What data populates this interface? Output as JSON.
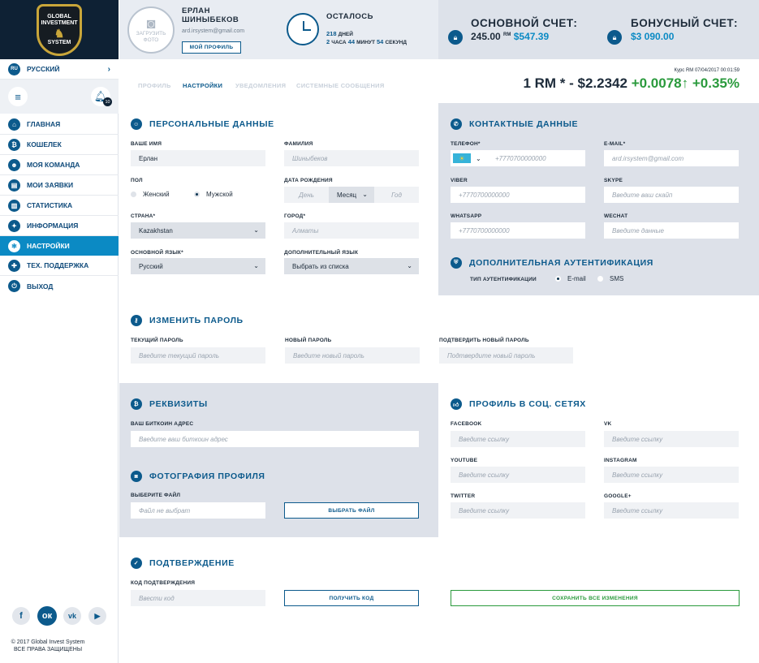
{
  "sidebar": {
    "logo": {
      "line1": "GLOBAL",
      "line2": "INVESTMENT",
      "line3": "SYSTEM"
    },
    "language": {
      "code": "RU",
      "label": "Русский"
    },
    "notifications_count": "10",
    "items": [
      {
        "label": "Главная",
        "icon": "home-icon"
      },
      {
        "label": "Кошелек",
        "icon": "bitcoin-icon"
      },
      {
        "label": "Моя команда",
        "icon": "team-icon"
      },
      {
        "label": "Мои заявки",
        "icon": "document-icon"
      },
      {
        "label": "Статистика",
        "icon": "chart-icon"
      },
      {
        "label": "Информация",
        "icon": "bulb-icon"
      },
      {
        "label": "Настройки",
        "icon": "gear-icon"
      },
      {
        "label": "Тех. поддержка",
        "icon": "lifebuoy-icon"
      },
      {
        "label": "Выход",
        "icon": "power-icon"
      }
    ],
    "socials": [
      "f",
      "ок",
      "vk",
      "▶"
    ],
    "copyright_line1": "© 2017 Global Invest System",
    "copyright_line2": "ВСЕ ПРАВА ЗАЩИЩЕНЫ"
  },
  "header": {
    "upload_photo": "загрузить фото",
    "user_name_line1": "Ерлан",
    "user_name_line2": "Шиныбеков",
    "user_email": "ard.irsystem@gmail.com",
    "profile_button": "Мой профиль",
    "remaining_title": "Осталось",
    "days_value": "218",
    "days_label": "дней",
    "hours_value": "2",
    "hours_label": "часа",
    "minutes_value": "44",
    "minutes_label": "минут",
    "seconds_value": "54",
    "seconds_label": "секунд",
    "main_account_title": "Основной счет:",
    "main_account_rm": "245.00",
    "rm_unit": "RM",
    "main_account_usd": "$547.39",
    "bonus_account_title": "Бонусный счет:",
    "bonus_account_usd": "$3 090.00"
  },
  "tabs": [
    {
      "label": "Профиль"
    },
    {
      "label": "Настройки"
    },
    {
      "label": "Уведомления"
    },
    {
      "label": "Системные сообщения"
    }
  ],
  "rate": {
    "caption": "Курс RM 07/04/2017 00:01:59",
    "value": "1 RM * - $2.2342",
    "change": "+0.0078↑",
    "percent": "+0.35%"
  },
  "personal": {
    "title": "Персональные данные",
    "name_label": "Ваше имя",
    "name_value": "Ерлан",
    "surname_label": "Фамилия",
    "surname_placeholder": "Шиныбеков",
    "gender_label": "Пол",
    "gender_female": "Женский",
    "gender_male": "Мужской",
    "birth_label": "Дата рождения",
    "birth_day": "День",
    "birth_month": "Месяц",
    "birth_year": "Год",
    "country_label": "Страна*",
    "country_value": "Kazakhstan",
    "city_label": "Город*",
    "city_placeholder": "Алматы",
    "main_lang_label": "Основной язык*",
    "main_lang_value": "Русский",
    "extra_lang_label": "Дополнительный язык",
    "extra_lang_value": "Выбрать из списка"
  },
  "contacts": {
    "title": "Контактные данные",
    "phone_label": "Телефон*",
    "phone_placeholder": "+7770700000000",
    "email_label": "E-mail*",
    "email_placeholder": "ard.irsystem@gmail.com",
    "viber_label": "Viber",
    "viber_placeholder": "+7770700000000",
    "skype_label": "Skype",
    "skype_placeholder": "Введите ваш скайп",
    "whatsapp_label": "WhatsApp",
    "whatsapp_placeholder": "+7770700000000",
    "wechat_label": "WeChat",
    "wechat_placeholder": "Введите данные"
  },
  "auth": {
    "title": "Дополнительная аутентификация",
    "type_label": "Тип аутентификации",
    "opt_email": "E-mail",
    "opt_sms": "SMS"
  },
  "password": {
    "title": "Изменить пароль",
    "current_label": "Текущий пароль",
    "current_placeholder": "Введите текущий пароль",
    "new_label": "Новый пароль",
    "new_placeholder": "Введите новый пароль",
    "confirm_label": "Подтвердить новый пароль",
    "confirm_placeholder": "Подтвердите новый пароль"
  },
  "requisites": {
    "title": "Реквизиты",
    "btc_label": "Ваш биткоин адрес",
    "btc_placeholder": "Введите ваш биткоин адрес"
  },
  "photo": {
    "title": "Фотография профиля",
    "file_label": "Выберите файл",
    "file_placeholder": "Файл не выбрат",
    "file_button": "Выбрать файл"
  },
  "social": {
    "title": "Профиль в соц. сетях",
    "link_placeholder": "Введите ссылку",
    "facebook": "Facebook",
    "vk": "VK",
    "youtube": "YouTube",
    "instagram": "Instagram",
    "twitter": "Twitter",
    "google": "Google+"
  },
  "confirm": {
    "title": "Подтверждение",
    "code_label": "Код подтверждения",
    "code_placeholder": "Ввести код",
    "get_code": "Получить код",
    "save_all": "Сохранить все изменения"
  }
}
